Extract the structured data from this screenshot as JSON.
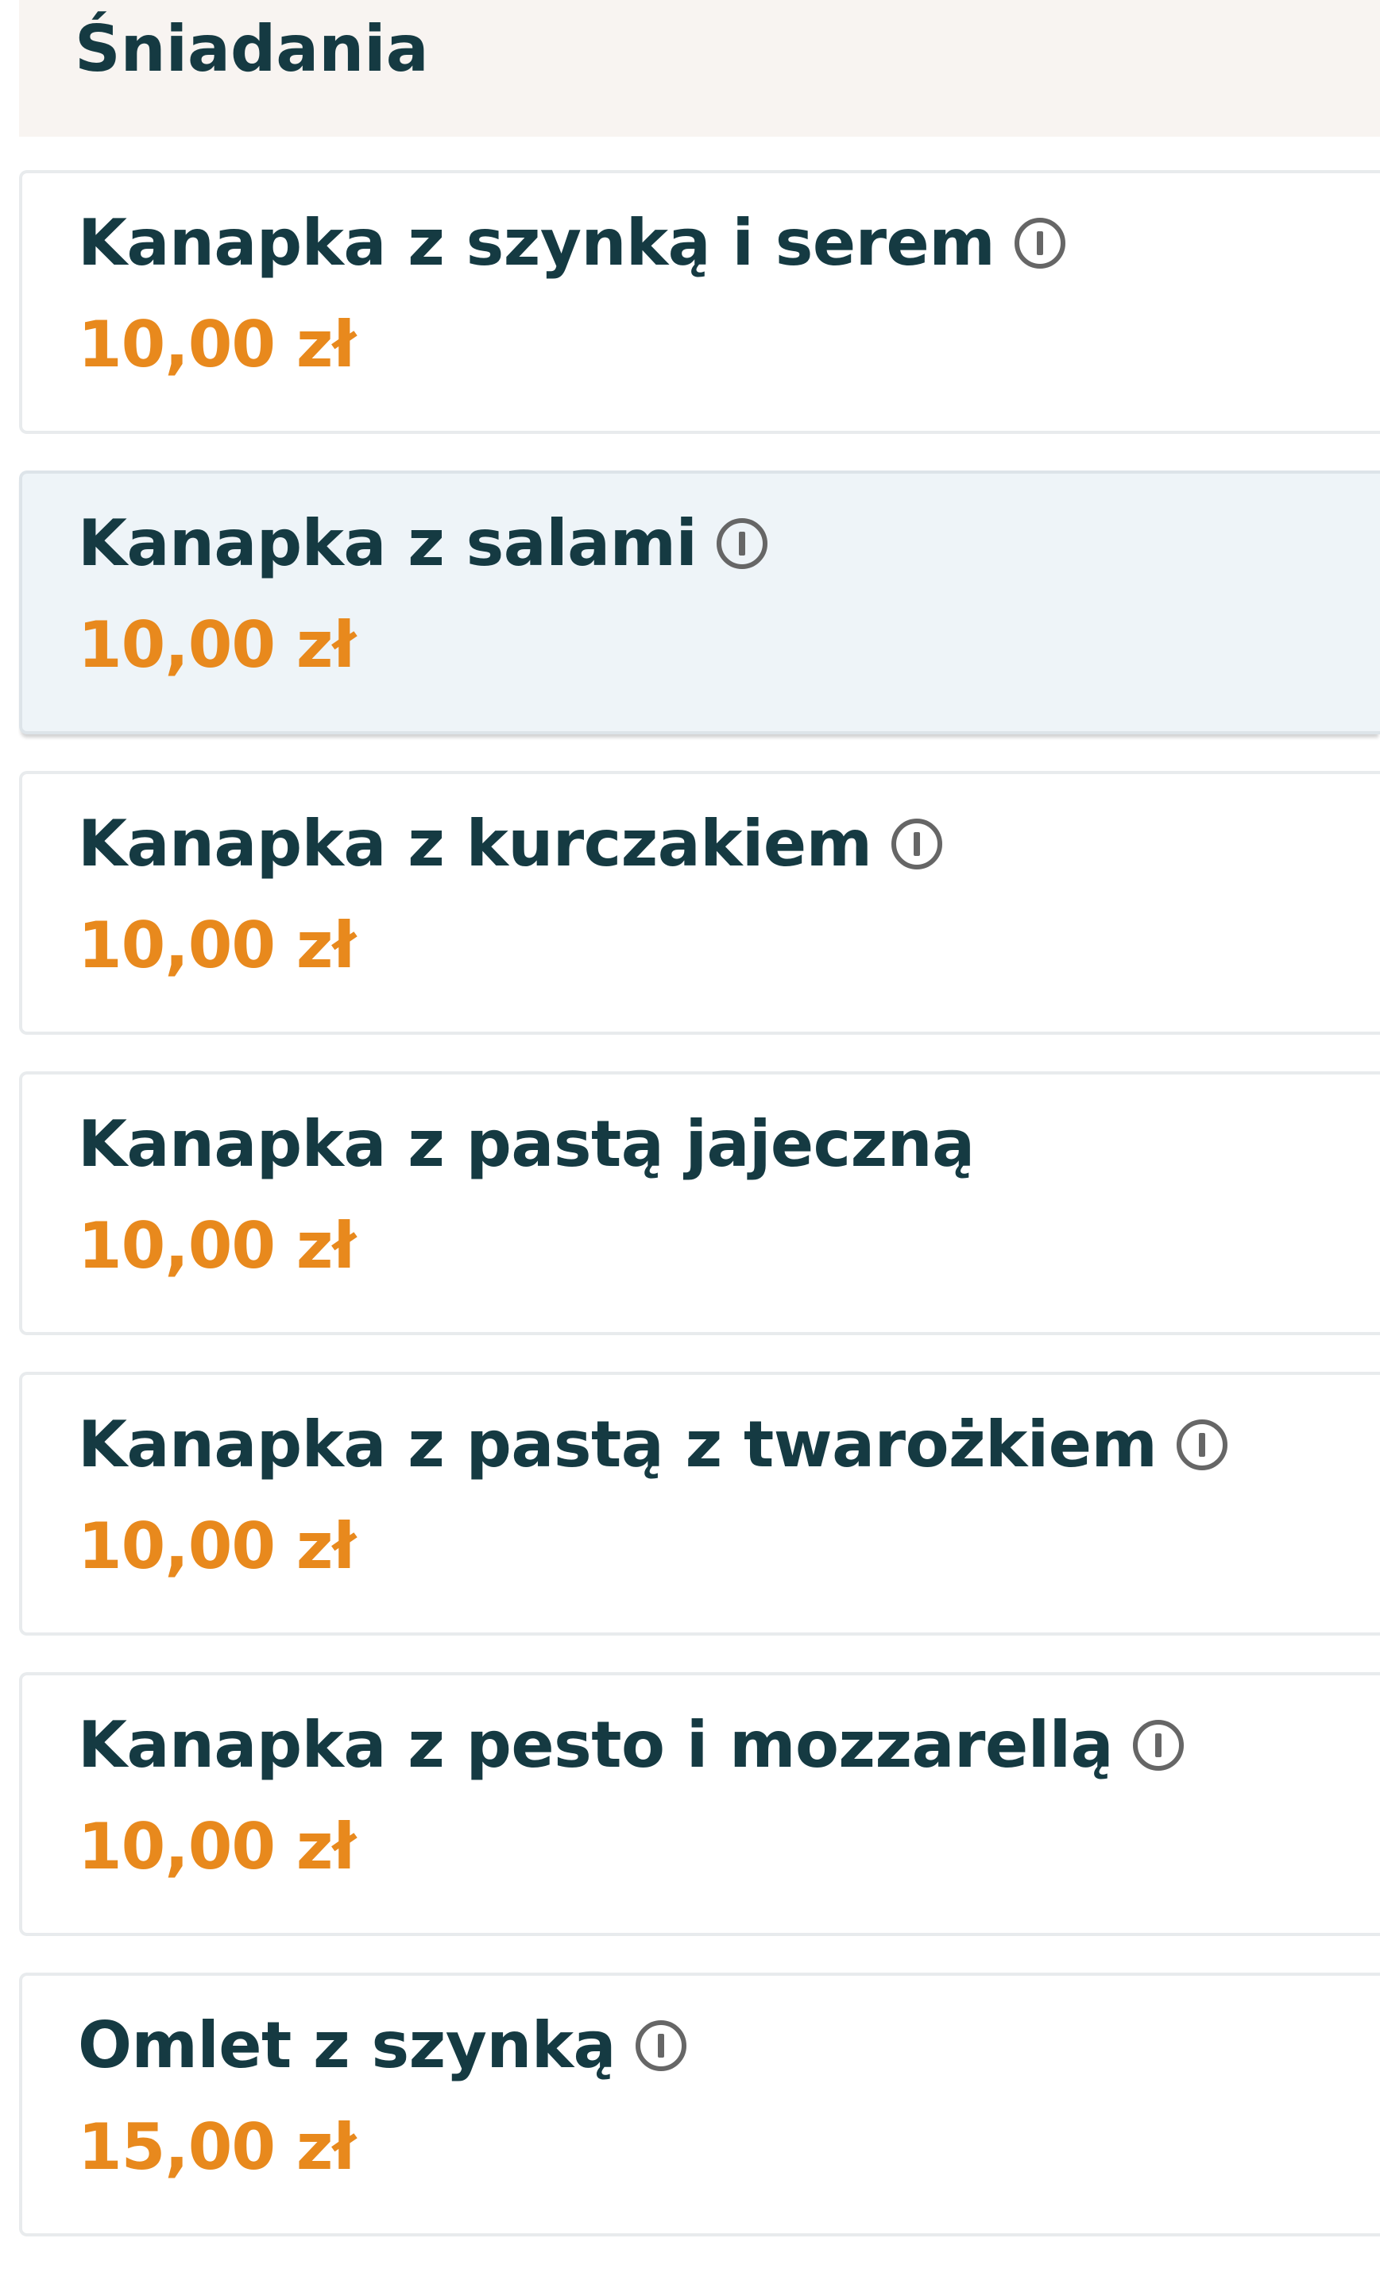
{
  "section": {
    "title": "Śniadania"
  },
  "colors": {
    "title_text": "#153a42",
    "price_text": "#e8891d",
    "header_bg": "#f8f4f1",
    "selected_bg": "#eef4f8",
    "icon": "#666666"
  },
  "items": [
    {
      "name": "Kanapka z szynką i serem",
      "price": "10,00 zł",
      "has_info": true,
      "icon": "info-icon"
    },
    {
      "name": "Kanapka z salami",
      "price": "10,00 zł",
      "has_info": true,
      "icon": "info-icon",
      "selected": true
    },
    {
      "name": "Kanapka z kurczakiem",
      "price": "10,00 zł",
      "has_info": true,
      "icon": "info-icon"
    },
    {
      "name": "Kanapka z pastą jajeczną",
      "price": "10,00 zł",
      "has_info": false
    },
    {
      "name": "Kanapka z pastą z twarożkiem",
      "price": "10,00 zł",
      "has_info": true,
      "icon": "info-icon"
    },
    {
      "name": "Kanapka z pesto i mozzarellą",
      "price": "10,00 zł",
      "has_info": true,
      "icon": "info-icon"
    },
    {
      "name": "Omlet z szynką",
      "price": "15,00 zł",
      "has_info": true,
      "icon": "info-icon"
    }
  ]
}
